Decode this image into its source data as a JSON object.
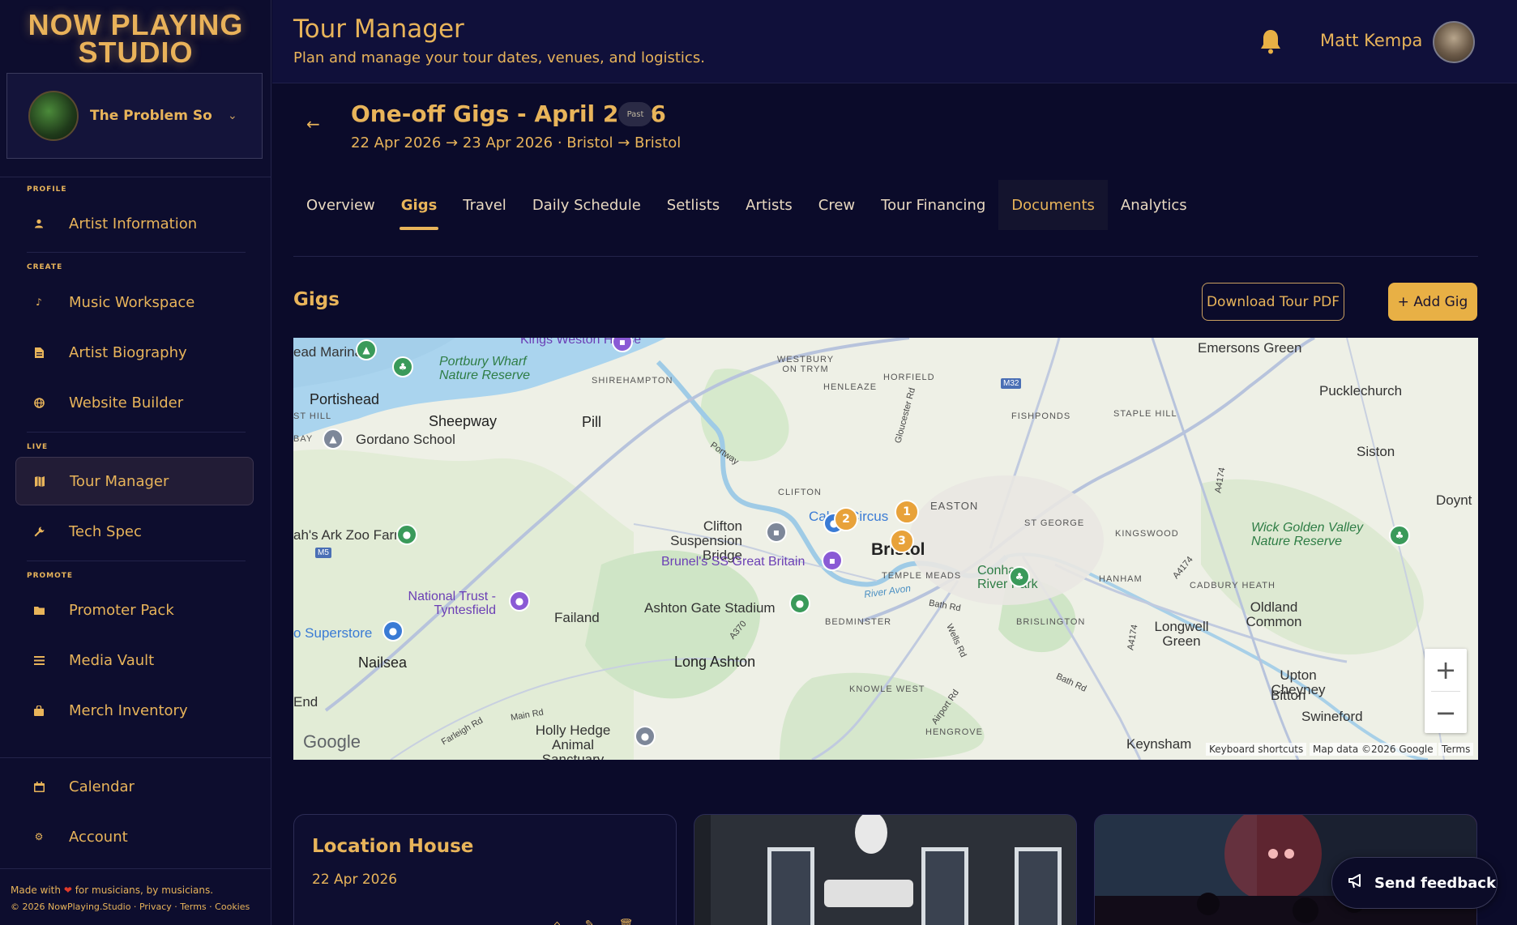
{
  "brand": {
    "line1": "NOW PLAYING",
    "line2": "STUDIO"
  },
  "artist_selector": {
    "name": "The Problem So...",
    "chevron_icon": "chevron-down-icon"
  },
  "sidebar": {
    "sections": {
      "profile": "PROFILE",
      "create": "CREATE",
      "live": "LIVE",
      "promote": "PROMOTE"
    },
    "items": [
      {
        "label": "Artist Information",
        "icon": "person-icon"
      },
      {
        "label": "Music Workspace",
        "icon": "music-note-icon"
      },
      {
        "label": "Artist Biography",
        "icon": "document-icon"
      },
      {
        "label": "Website Builder",
        "icon": "globe-icon"
      },
      {
        "label": "Tour Manager",
        "icon": "map-icon",
        "active": true
      },
      {
        "label": "Tech Spec",
        "icon": "wrench-icon"
      },
      {
        "label": "Promoter Pack",
        "icon": "folder-icon"
      },
      {
        "label": "Media Vault",
        "icon": "list-icon"
      },
      {
        "label": "Merch Inventory",
        "icon": "bag-icon"
      },
      {
        "label": "Calendar",
        "icon": "calendar-icon"
      },
      {
        "label": "Account",
        "icon": "gear-icon"
      }
    ],
    "footer": {
      "made_with_prefix": "Made with",
      "made_with_suffix": "for musicians, by musicians.",
      "copyright": "© 2026",
      "brand_link": "NowPlaying.Studio",
      "privacy": "Privacy",
      "terms": "Terms",
      "cookies": "Cookies"
    }
  },
  "header": {
    "title": "Tour Manager",
    "subtitle": "Plan and manage your tour dates, venues, and logistics.",
    "user_name": "Matt Kempa"
  },
  "tour": {
    "title": "One-off Gigs - April 2026",
    "badge": "Past",
    "dates": "22 Apr 2026 → 23 Apr 2026 · Bristol → Bristol"
  },
  "tabs": [
    {
      "label": "Overview"
    },
    {
      "label": "Gigs",
      "active": true
    },
    {
      "label": "Travel"
    },
    {
      "label": "Daily Schedule"
    },
    {
      "label": "Setlists"
    },
    {
      "label": "Artists"
    },
    {
      "label": "Crew"
    },
    {
      "label": "Tour Financing"
    },
    {
      "label": "Documents",
      "hover": true
    },
    {
      "label": "Analytics"
    }
  ],
  "gigs_section": {
    "title": "Gigs",
    "download_pdf": "Download Tour PDF",
    "add_gig": "+ Add Gig"
  },
  "map": {
    "labels": {
      "emersons_green": "Emersons Green",
      "pucklechurch": "Pucklechurch",
      "siston": "Siston",
      "doynton": "Doynt",
      "kings_weston": "Kings Weston House",
      "marina": "ead Marina",
      "portbury": "Portbury Wharf Nature Reserve",
      "portishead": "Portishead",
      "sheepway": "Sheepway",
      "pill": "Pill",
      "gordano": "Gordano School",
      "st_hill": "ST HILL",
      "bay": "BAY",
      "shirehampton": "SHIREHAMPTON",
      "westbury": "WESTBURY ON TRYM",
      "henleaze": "HENLEAZE",
      "horfield": "HORFIELD",
      "fishponds": "FISHPONDS",
      "staple_hill": "STAPLE HILL",
      "clifton": "CLIFTON",
      "easton": "EASTON",
      "st_george": "ST GEORGE",
      "kingswood": "KINGSWOOD",
      "wick": "Wick Golden Valley Nature Reserve",
      "noahs_ark": "ah's Ark Zoo Farm",
      "clifton_bridge": "Clifton Suspension Bridge",
      "cabot": "Cabot Circus",
      "bristol": "Bristol",
      "brunel": "Brunel's SS Great Britain",
      "temple_meads": "TEMPLE MEADS",
      "conham": "Conham River Park",
      "hanham": "HANHAM",
      "cadbury": "CADBURY HEATH",
      "national_trust": "National Trust - Tyntesfield",
      "failand": "Failand",
      "ashton_gate": "Ashton Gate Stadium",
      "bedminster": "BEDMINSTER",
      "brislington": "BRISLINGTON",
      "longwell": "Longwell Green",
      "oldland": "Oldland Common",
      "superstore": "o Superstore",
      "nailsea": "Nailsea",
      "long_ashton": "Long Ashton",
      "knowle": "KNOWLE WEST",
      "upton": "Upton Cheyney",
      "bitton": "Bitton",
      "swineford": "Swineford",
      "end": "End",
      "holly_hedge": "Holly Hedge Animal Sanctuary",
      "hengrove": "HENGROVE",
      "keynsham": "Keynsham",
      "river_avon": "River Avon",
      "portway": "Portway",
      "gloucester_rd": "Gloucester Rd",
      "bath_rd": "Bath Rd",
      "wells_rd": "Wells Rd",
      "airport_rd": "Airport Rd",
      "main_rd": "Main Rd",
      "farleigh_rd": "Farleigh Rd",
      "m32": "M32",
      "m5": "M5",
      "a370": "A370",
      "a4174a": "A4174",
      "a4174b": "A4174",
      "a4174c": "A4174",
      "bath_rd2": "Bath Rd"
    },
    "clusters": [
      "1",
      "2",
      "3"
    ],
    "google": "Google",
    "keyboard": "Keyboard shortcuts",
    "map_data": "Map data ©2026 Google",
    "terms": "Terms",
    "zoom_in": "+",
    "zoom_out": "−"
  },
  "gig_card": {
    "name": "Location House",
    "date": "22 Apr 2026",
    "actions": [
      "home-icon",
      "edit-icon",
      "trash-icon"
    ]
  },
  "feedback": {
    "label": "Send feedback",
    "icon": "megaphone-icon"
  },
  "colors": {
    "accent": "#e8b45a",
    "background": "#0b0b2a",
    "cluster": "#e8a23a"
  }
}
